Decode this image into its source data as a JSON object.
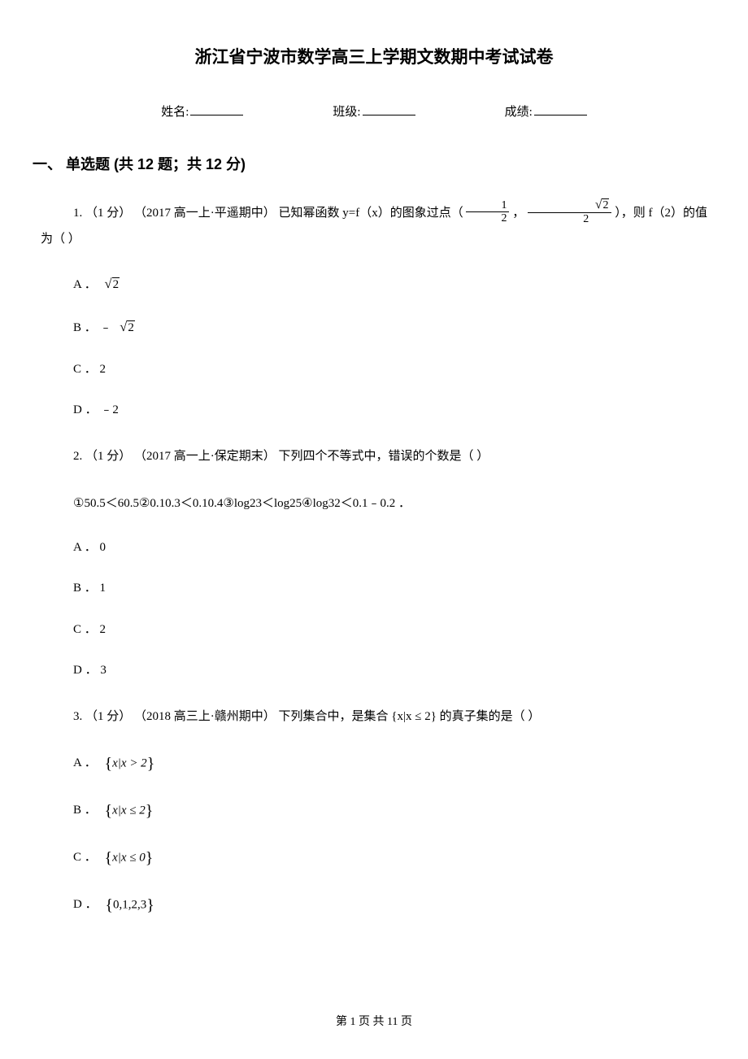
{
  "title": "浙江省宁波市数学高三上学期文数期中考试试卷",
  "info": {
    "name_label": "姓名:",
    "class_label": "班级:",
    "score_label": "成绩:"
  },
  "section1": {
    "header": "一、 单选题 (共 12 题；共 12 分)"
  },
  "q1": {
    "num": "1. ",
    "points": "（1 分）",
    "source": "（2017 高一上·平遥期中）",
    "stem_before": "已知幂函数 y=f（x）的图象过点（",
    "point_sep": " ， ",
    "stem_after": "），则 f（2）的值为（   ）",
    "optA_label": "A ．",
    "optB_label": "B ． ﹣",
    "optC_label": "C ． 2",
    "optD_label": "D ． ﹣2"
  },
  "q2": {
    "num": "2. ",
    "points": "（1 分）",
    "source": "（2017 高一上·保定期末）",
    "stem": "下列四个不等式中，错误的个数是（     ）",
    "items": "①50.5＜60.5②0.10.3＜0.10.4③log23＜log25④log32＜0.1﹣0.2 ．",
    "optA": "A ． 0",
    "optB": "B ． 1",
    "optC": "C ． 2",
    "optD": "D ． 3"
  },
  "q3": {
    "num": "3. ",
    "points": "（1 分）",
    "source": "（2018 高三上·赣州期中）",
    "stem_before": "下列集合中，是集合 ",
    "set_expr": "{x|x ≤ 2}",
    "stem_after": " 的真子集的是（     ）",
    "optA_label": "A ．",
    "optA_expr": "{x|x > 2}",
    "optB_label": "B ．",
    "optB_expr": "{x|x ≤ 2}",
    "optC_label": "C ．",
    "optC_expr": "{x|x ≤ 0}",
    "optD_label": "D ．",
    "optD_expr": "{0,1,2,3}"
  },
  "footer": {
    "text": "第 1 页 共 11 页"
  }
}
